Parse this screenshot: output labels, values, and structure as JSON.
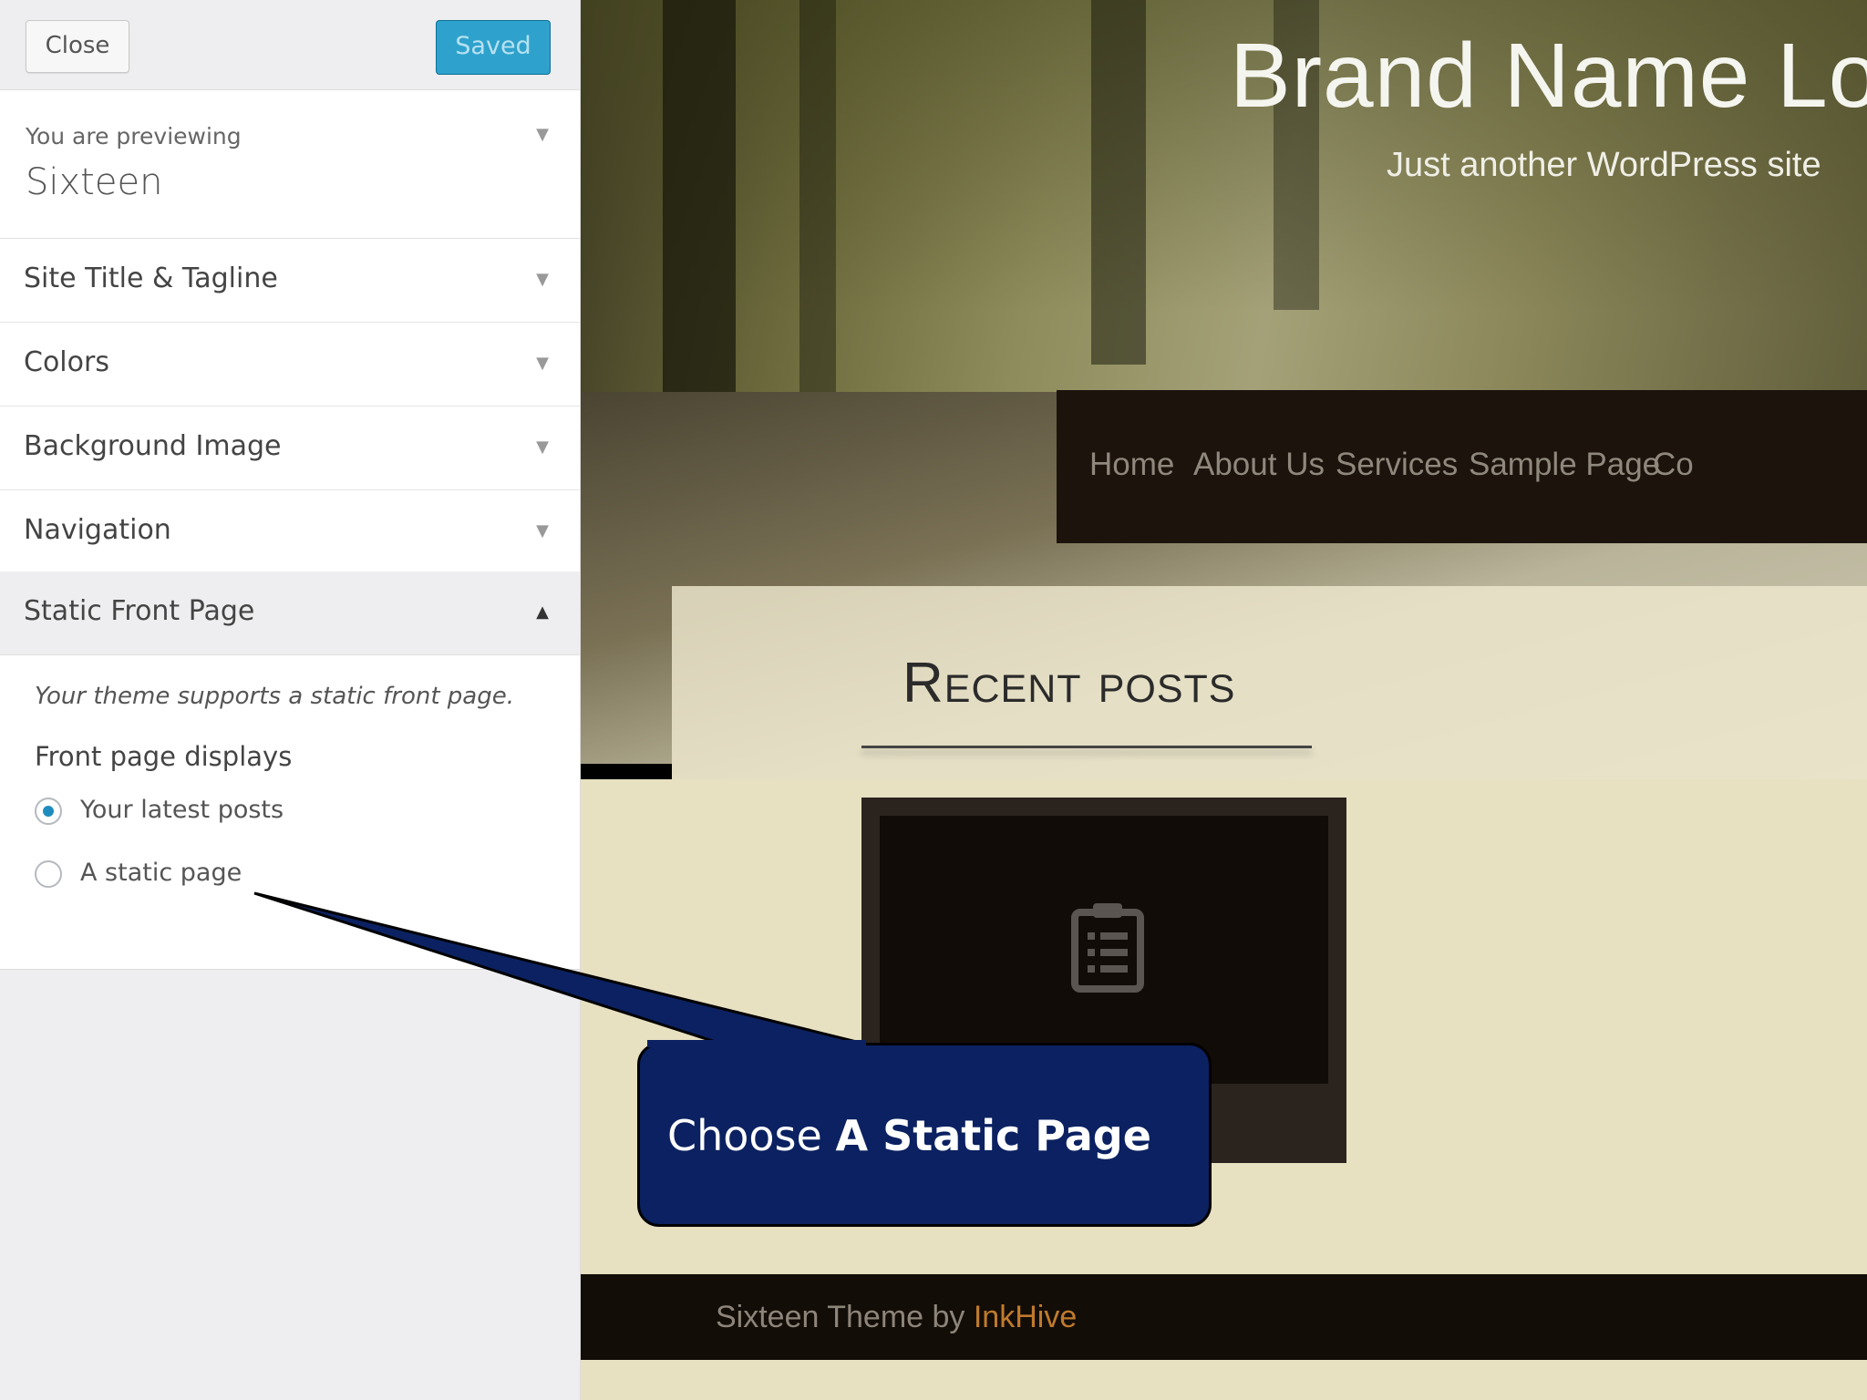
{
  "header": {
    "close_label": "Close",
    "saved_label": "Saved"
  },
  "theme_preview": {
    "label": "You are previewing",
    "theme_name": "Sixteen"
  },
  "sections": [
    {
      "label": "Site Title & Tagline"
    },
    {
      "label": "Colors"
    },
    {
      "label": "Background Image"
    },
    {
      "label": "Navigation"
    },
    {
      "label": "Static Front Page"
    }
  ],
  "static_front_page": {
    "description": "Your theme supports a static front page.",
    "front_label": "Front page displays",
    "options": [
      {
        "label": "Your latest posts",
        "checked": true
      },
      {
        "label": "A static page",
        "checked": false
      }
    ]
  },
  "site": {
    "title": "Brand Name Lo",
    "tagline": "Just another WordPress site",
    "menu": [
      {
        "label": "Home"
      },
      {
        "label": "About Us"
      },
      {
        "label": "Services"
      },
      {
        "label": "Sample Page"
      },
      {
        "label": "Co"
      }
    ],
    "recent_posts_title": "Recent posts",
    "footer_text": "Sixteen Theme by ",
    "footer_link": "InkHive"
  },
  "callout": {
    "prefix": "Choose ",
    "strong": "A Static Page",
    "color": "#0b2161"
  },
  "icons": {
    "post_placeholder": "clipboard-icon",
    "collapsed": "triangle-down-icon",
    "expanded": "triangle-up-icon"
  },
  "colors": {
    "accent": "#2ea2cc",
    "radio_checked": "#1e8cbe"
  }
}
